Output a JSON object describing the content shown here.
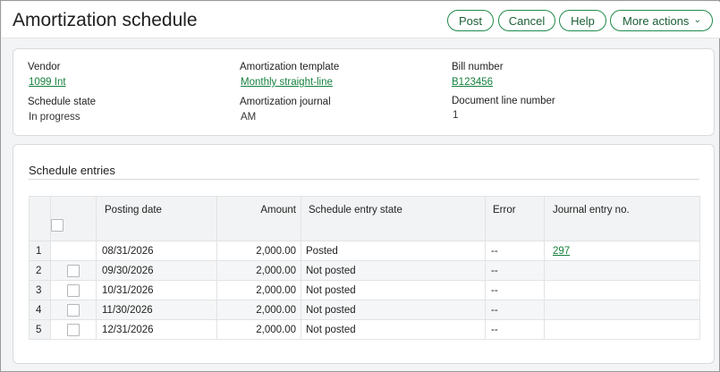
{
  "header": {
    "title": "Amortization schedule",
    "buttons": {
      "post": "Post",
      "cancel": "Cancel",
      "help": "Help",
      "more_actions": "More actions"
    },
    "accent_color": "#1f8a4c"
  },
  "details": {
    "vendor_label": "Vendor",
    "vendor_value": "1099 Int",
    "template_label": "Amortization template",
    "template_value": "Monthly straight-line",
    "bill_label": "Bill number",
    "bill_value": "B123456",
    "state_label": "Schedule state",
    "state_value": "In progress",
    "journal_label": "Amortization journal",
    "journal_value": "AM",
    "docline_label": "Document line number",
    "docline_value": "1"
  },
  "entries": {
    "title": "Schedule entries",
    "columns": {
      "posting_date": "Posting date",
      "amount": "Amount",
      "state": "Schedule entry state",
      "error": "Error",
      "journal_entry": "Journal entry no."
    },
    "rows": [
      {
        "num": "1",
        "date": "08/31/2026",
        "amount": "2,000.00",
        "state": "Posted",
        "error": "--",
        "je": "297",
        "selectable": false
      },
      {
        "num": "2",
        "date": "09/30/2026",
        "amount": "2,000.00",
        "state": "Not posted",
        "error": "--",
        "je": "",
        "selectable": true
      },
      {
        "num": "3",
        "date": "10/31/2026",
        "amount": "2,000.00",
        "state": "Not posted",
        "error": "--",
        "je": "",
        "selectable": true
      },
      {
        "num": "4",
        "date": "11/30/2026",
        "amount": "2,000.00",
        "state": "Not posted",
        "error": "--",
        "je": "",
        "selectable": true
      },
      {
        "num": "5",
        "date": "12/31/2026",
        "amount": "2,000.00",
        "state": "Not posted",
        "error": "--",
        "je": "",
        "selectable": true
      }
    ]
  }
}
